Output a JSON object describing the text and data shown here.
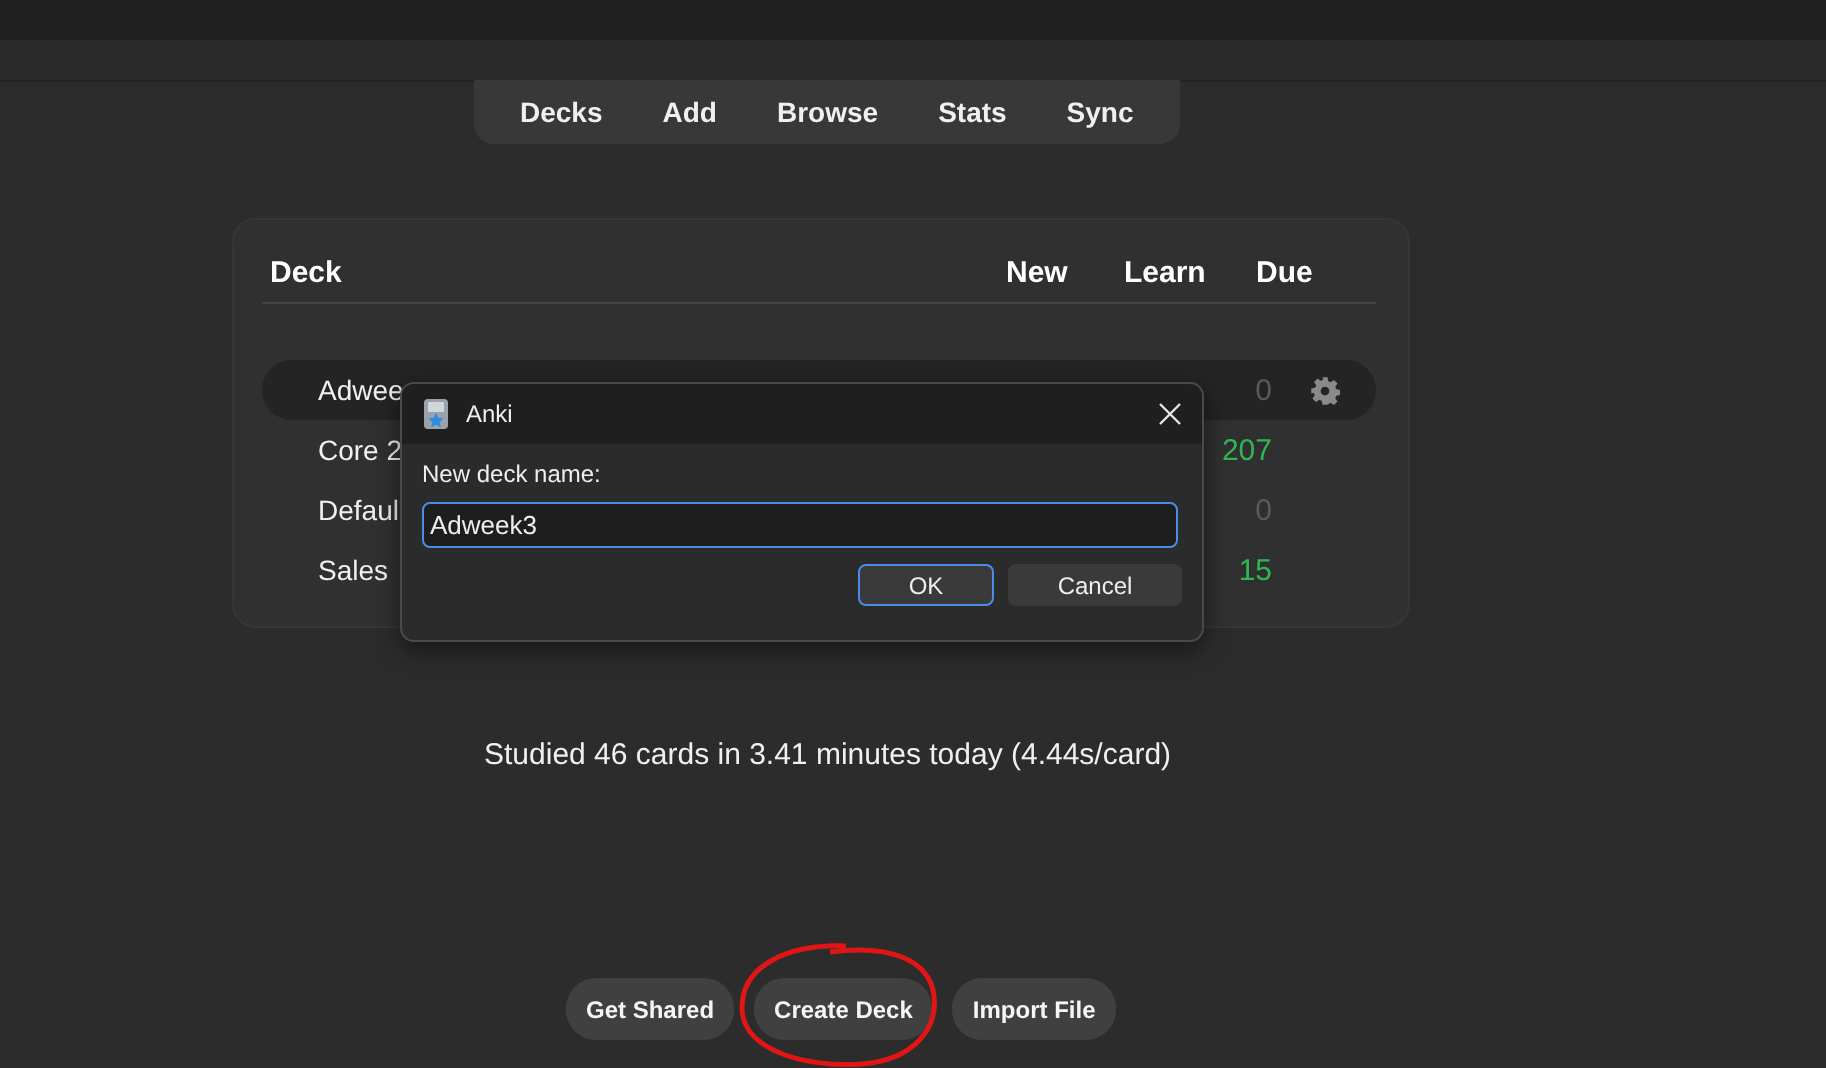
{
  "toolbar": [
    {
      "label": "Decks"
    },
    {
      "label": "Add"
    },
    {
      "label": "Browse"
    },
    {
      "label": "Stats"
    },
    {
      "label": "Sync"
    }
  ],
  "deck_table": {
    "columns": [
      "Deck",
      "New",
      "Learn",
      "Due"
    ],
    "rows": [
      {
        "name": "Adwee",
        "due": "0",
        "color": "#5a5a5a",
        "selected": true
      },
      {
        "name": "Core 2",
        "due": "207",
        "color": "#2fb84f",
        "selected": false
      },
      {
        "name": "Defaul",
        "due": "0",
        "color": "#5a5a5a",
        "selected": false
      },
      {
        "name": "Sales",
        "due": "15",
        "color": "#2fb84f",
        "selected": false
      }
    ]
  },
  "stats_text": "Studied 46 cards in 3.41 minutes today (4.44s/card)",
  "bottom_buttons": [
    {
      "label": "Get Shared",
      "highlighted": false
    },
    {
      "label": "Create Deck",
      "highlighted": true
    },
    {
      "label": "Import File",
      "highlighted": false
    }
  ],
  "dialog": {
    "title": "Anki",
    "label": "New deck name:",
    "value": "Adweek3",
    "buttons": [
      {
        "label": "OK",
        "default": true
      },
      {
        "label": "Cancel",
        "default": false
      }
    ]
  }
}
